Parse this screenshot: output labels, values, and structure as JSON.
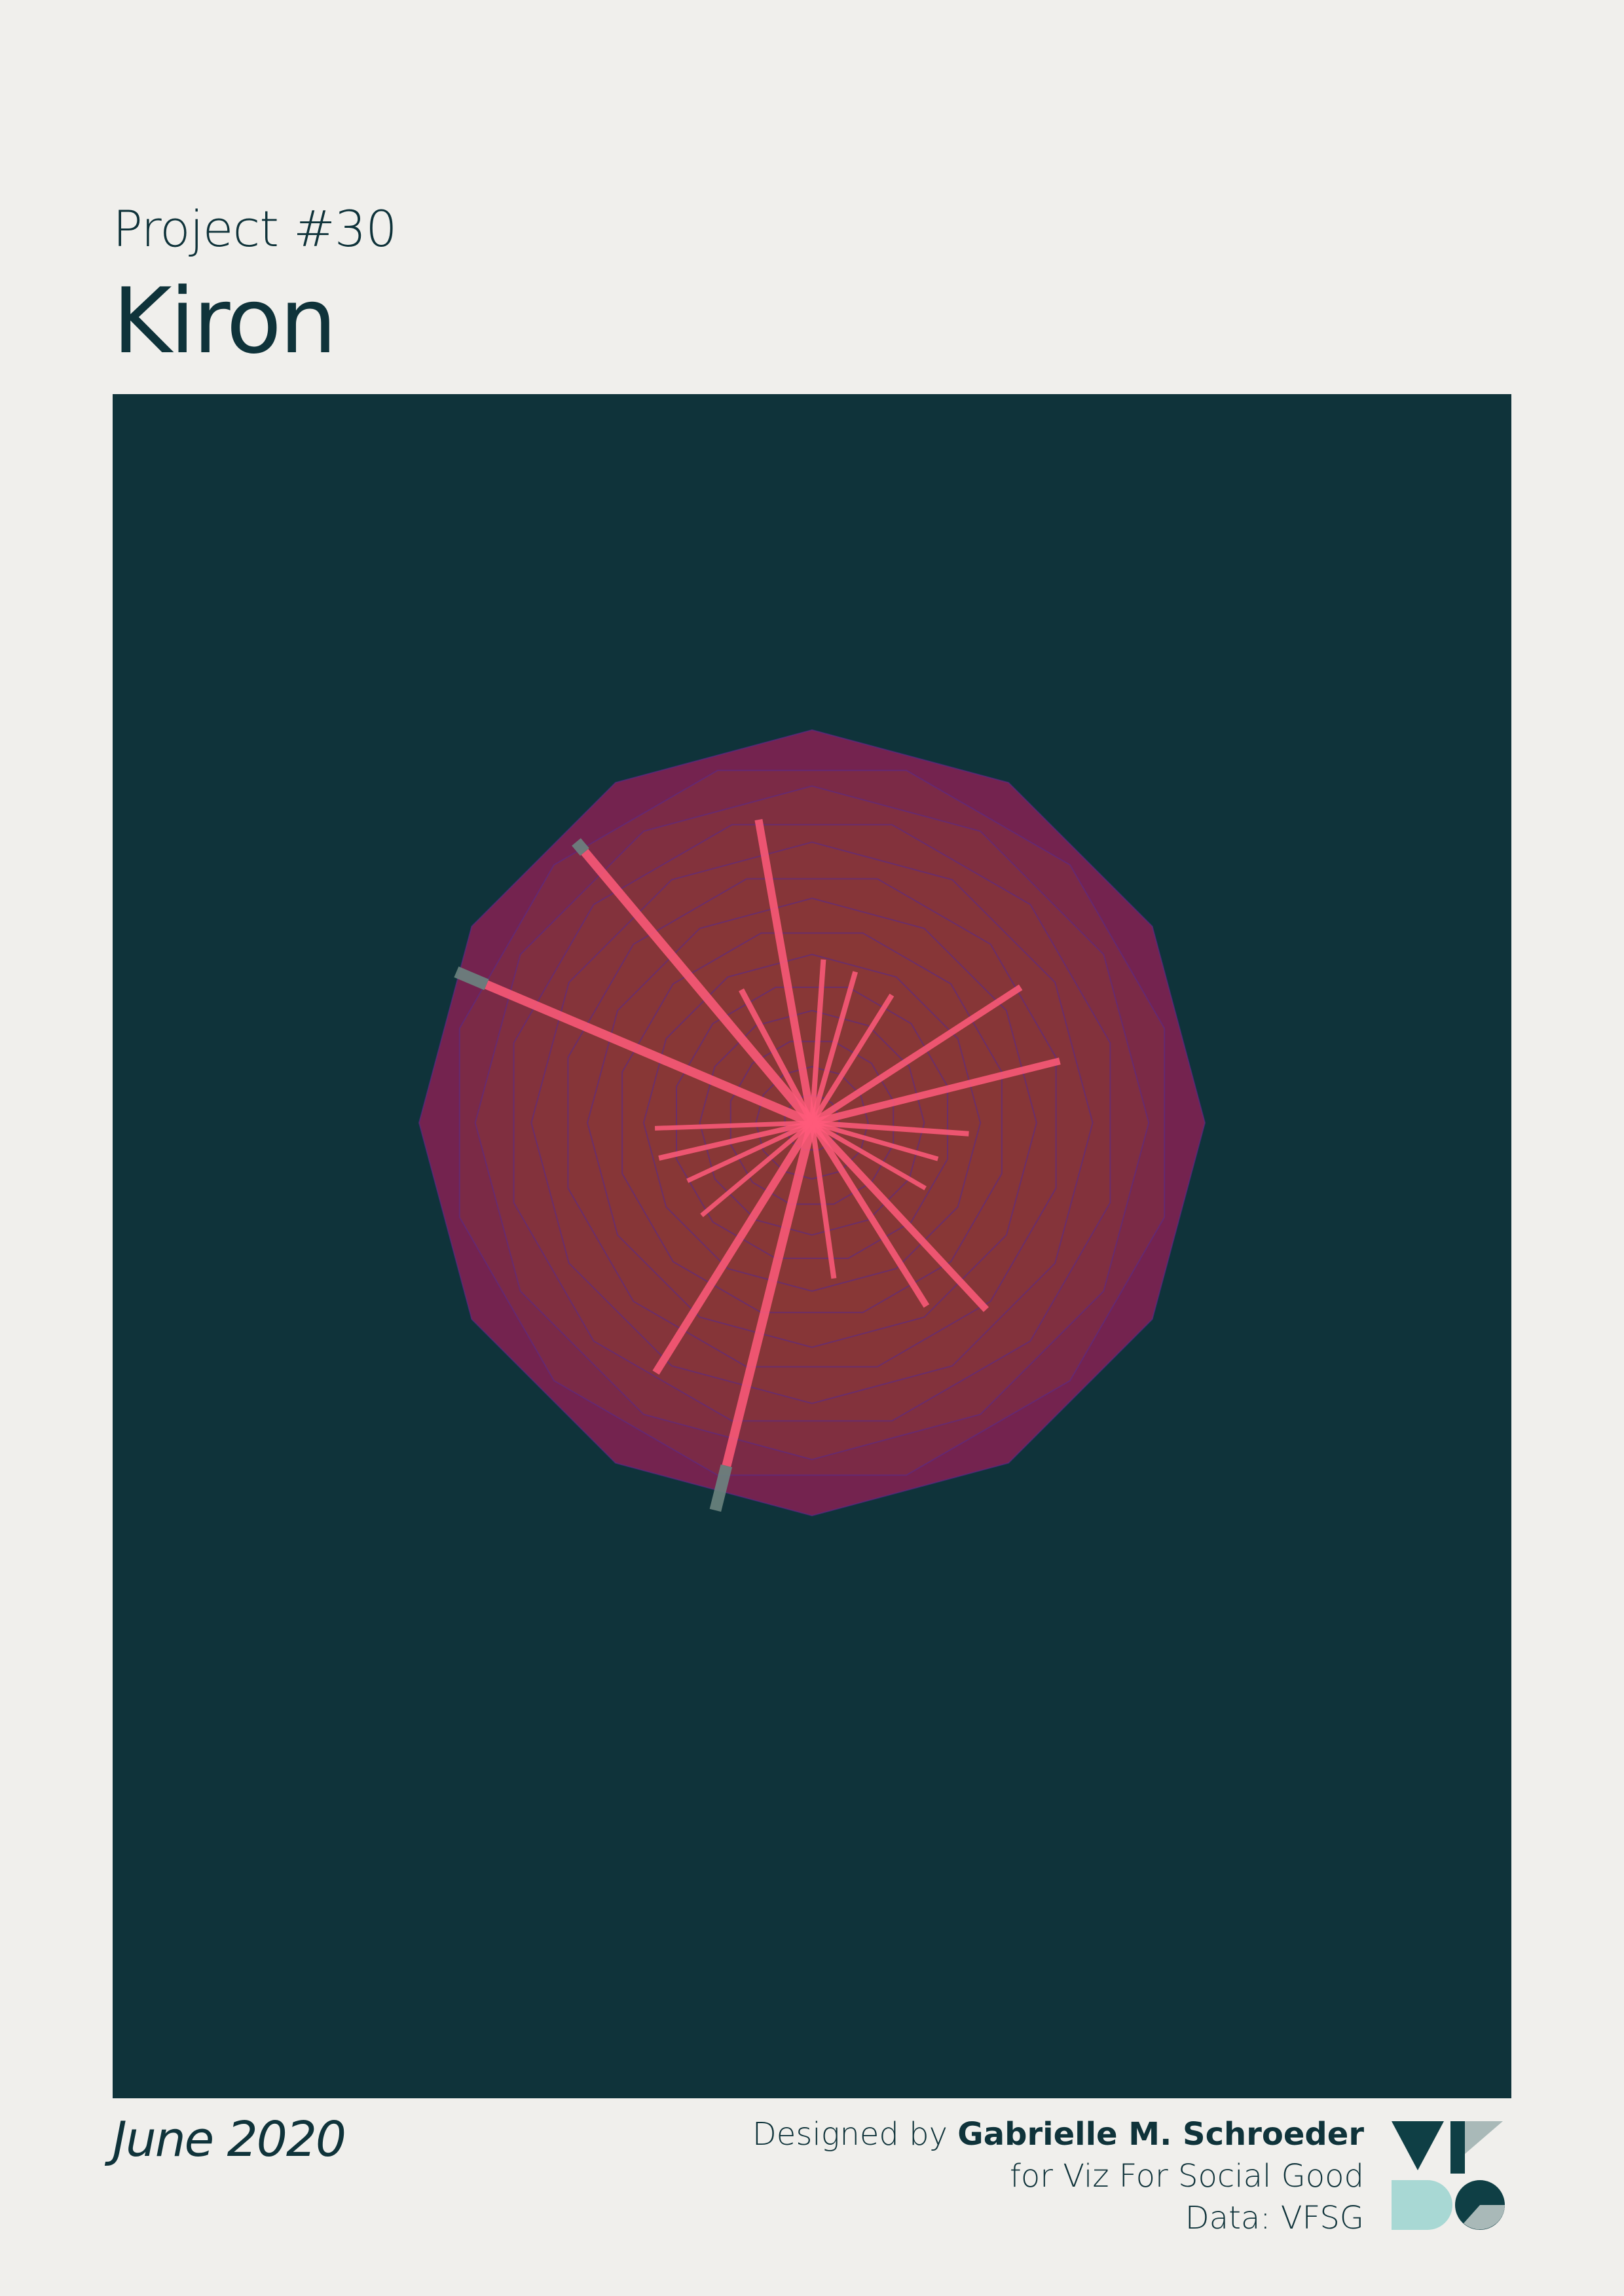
{
  "header": {
    "project_label": "Project #30",
    "title": "Kiron"
  },
  "footer": {
    "date": "June 2020",
    "designed_by_prefix": "Designed by",
    "designer_name": "Gabrielle M. Schroeder",
    "for_line": "for Viz For Social Good",
    "data_line": "Data: VFSG"
  },
  "colors": {
    "background": "#f0efec",
    "panel": "#0f333a",
    "polygon_outer": "#7a2350",
    "polygon_inner": "#8a3a36",
    "polygon_stroke": "#5a2a8a",
    "spoke": "#ff5a7a",
    "spoke_overflow": "#6b8480",
    "logo_dark": "#0f3f45",
    "logo_teal": "#a8d8d4",
    "logo_gray": "#a9b9b8"
  },
  "icons": {
    "logo": "vfsg-logo-icon"
  }
}
